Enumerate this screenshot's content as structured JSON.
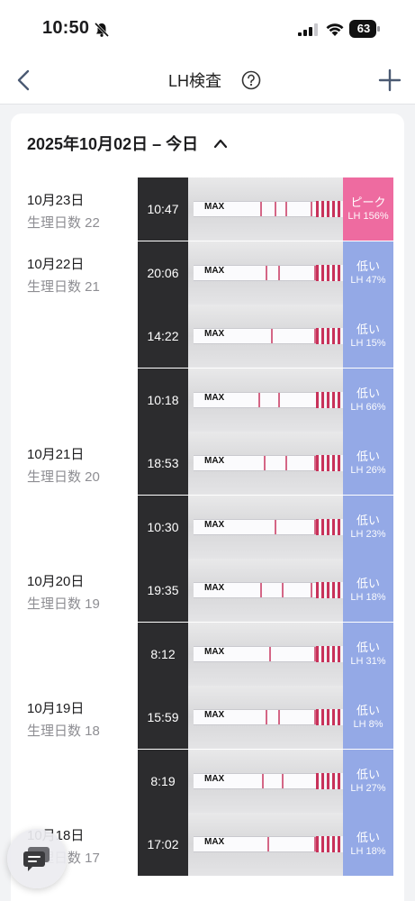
{
  "status_bar": {
    "time": "10:50",
    "battery": "63"
  },
  "nav": {
    "title": "LH検査"
  },
  "section": {
    "title": "2025年10月02日 – 今日"
  },
  "colors": {
    "peak": "#ee6ba0",
    "low": "#94a9e6",
    "time_bg": "#2c2c2e"
  },
  "entries": [
    {
      "date": "10月23日",
      "cycle": "生理日数 22",
      "time": "10:47",
      "result": "ピーク",
      "lh": "LH 156%",
      "level": "peak"
    },
    {
      "date": "10月22日",
      "cycle": "生理日数 21",
      "time": "20:06",
      "result": "低い",
      "lh": "LH 47%",
      "level": "low"
    },
    {
      "date": "",
      "cycle": "",
      "time": "14:22",
      "result": "低い",
      "lh": "LH 15%",
      "level": "low"
    },
    {
      "date": "",
      "cycle": "",
      "time": "10:18",
      "result": "低い",
      "lh": "LH 66%",
      "level": "low"
    },
    {
      "date": "10月21日",
      "cycle": "生理日数 20",
      "time": "18:53",
      "result": "低い",
      "lh": "LH 26%",
      "level": "low"
    },
    {
      "date": "",
      "cycle": "",
      "time": "10:30",
      "result": "低い",
      "lh": "LH 23%",
      "level": "low"
    },
    {
      "date": "10月20日",
      "cycle": "生理日数 19",
      "time": "19:35",
      "result": "低い",
      "lh": "LH 18%",
      "level": "low"
    },
    {
      "date": "",
      "cycle": "",
      "time": "8:12",
      "result": "低い",
      "lh": "LH 31%",
      "level": "low"
    },
    {
      "date": "10月19日",
      "cycle": "生理日数 18",
      "time": "15:59",
      "result": "低い",
      "lh": "LH 8%",
      "level": "low"
    },
    {
      "date": "",
      "cycle": "",
      "time": "8:19",
      "result": "低い",
      "lh": "LH 27%",
      "level": "low"
    },
    {
      "date": "10月18日",
      "cycle": "生理日数 17",
      "time": "17:02",
      "result": "低い",
      "lh": "LH 18%",
      "level": "low"
    }
  ],
  "strip_text": "MAX"
}
